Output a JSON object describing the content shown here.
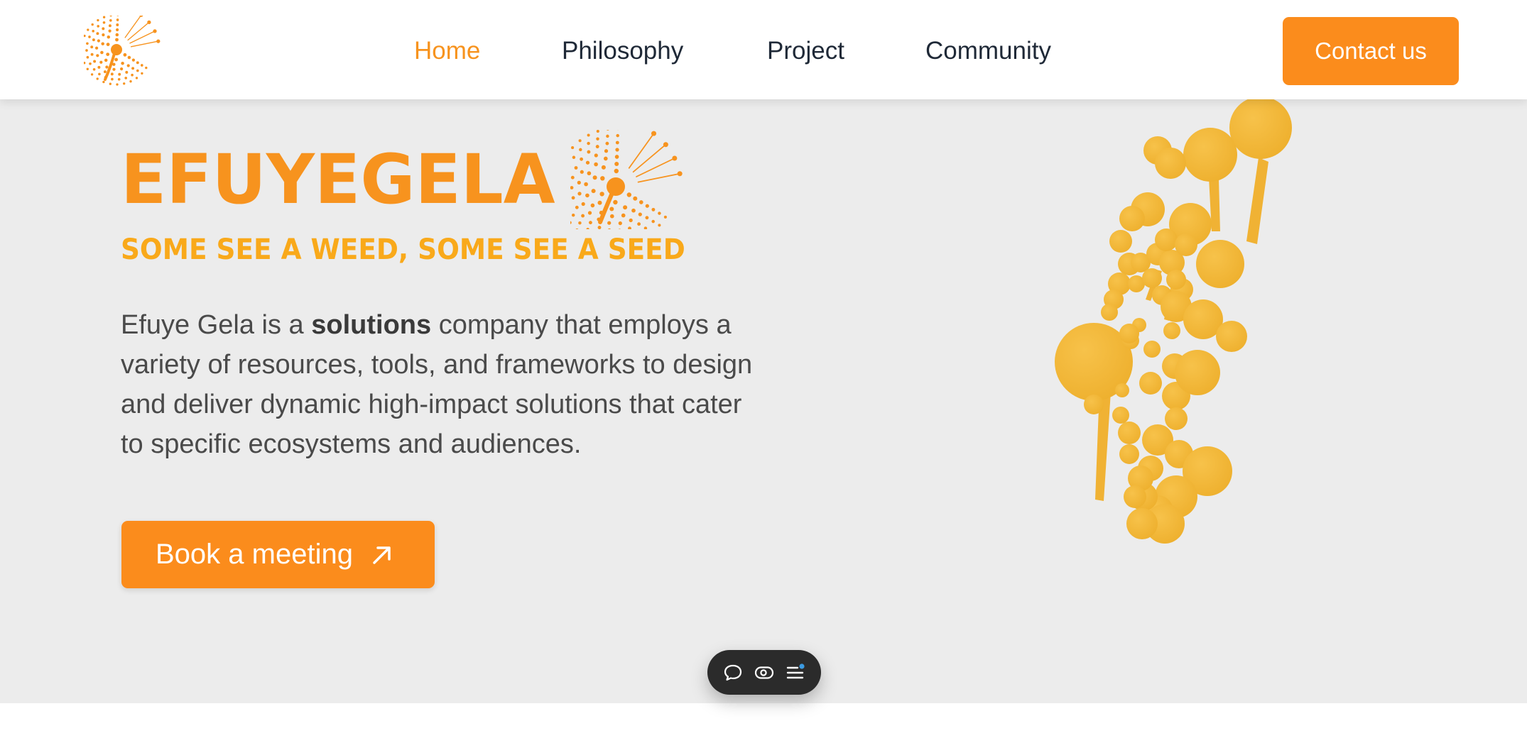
{
  "nav": {
    "items": [
      {
        "label": "Home",
        "active": true
      },
      {
        "label": "Philosophy",
        "active": false
      },
      {
        "label": "Project",
        "active": false
      },
      {
        "label": "Community",
        "active": false
      }
    ],
    "contact_label": "Contact us"
  },
  "hero": {
    "title": "EFUYEGELA",
    "tagline": "SOME SEE A WEED, SOME SEE A SEED",
    "description": {
      "before": "Efuye Gela is a ",
      "bold": "solutions",
      "after": " company that employs a variety of resources, tools, and frameworks to design and deliver dynamic high-impact solutions that cater to specific ecosystems and audiences."
    },
    "cta_label": "Book a meeting",
    "cta_icon": "arrow-up-right-icon"
  },
  "toolbar": {
    "icons": [
      "comment-icon",
      "eye-toggle-icon",
      "menu-list-icon"
    ]
  },
  "colors": {
    "accent": "#f7931e",
    "button": "#fb8c1c",
    "tagline": "#f9a91a",
    "hero_bg": "#ececec",
    "footprint": "#f2b737",
    "text": "#4a4a4a",
    "nav_text": "#1f2937",
    "toolbar_bg": "#2b2b2b",
    "notification_dot": "#3b9ae1"
  }
}
